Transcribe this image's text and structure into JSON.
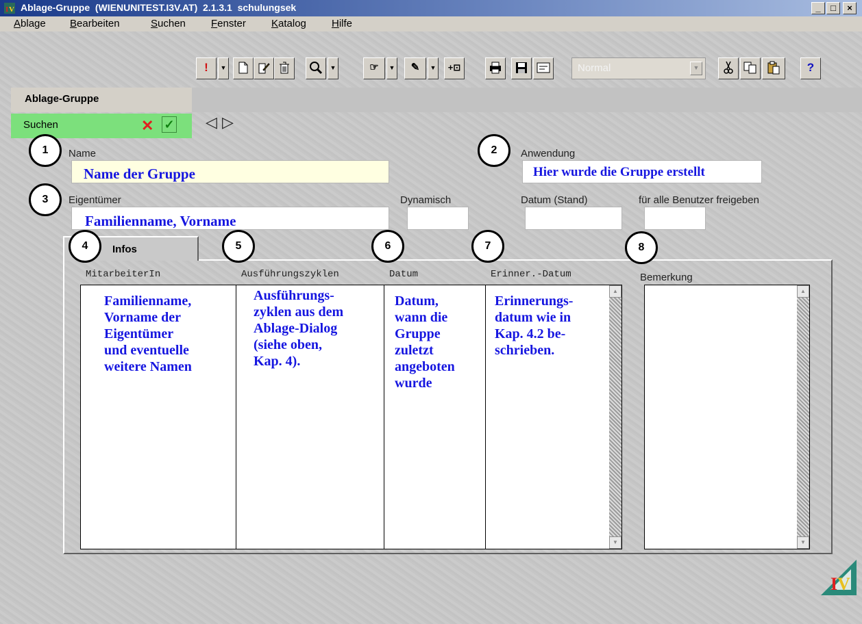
{
  "window": {
    "title": "Ablage-Gruppe  (WIENUNITEST.I3V.AT)  2.1.3.1  schulungsek",
    "minimize": "_",
    "maximize": "□",
    "close": "×"
  },
  "menu": [
    {
      "key": "A",
      "rest": "blage"
    },
    {
      "key": "B",
      "rest": "earbeiten"
    },
    {
      "key": "S",
      "rest": "uchen"
    },
    {
      "key": "F",
      "rest": "enster"
    },
    {
      "key": "K",
      "rest": "atalog"
    },
    {
      "key": "H",
      "rest": "ilfe"
    }
  ],
  "toolbar": {
    "style_select_value": "Normal",
    "help": "?"
  },
  "dialog": {
    "title": "Ablage-Gruppe",
    "mode_label": "Suchen"
  },
  "fields": {
    "name_label": "Name",
    "name_note": "Name der Gruppe",
    "anwendung_label": "Anwendung",
    "anwendung_note": "Hier wurde die Gruppe erstellt",
    "eigentuemer_label": "Eigentümer",
    "eigentuemer_note": "Familienname, Vorname",
    "dynamisch_label": "Dynamisch",
    "datum_stand_label": "Datum (Stand)",
    "freigeben_label": "für alle Benutzer freigeben"
  },
  "tab": {
    "label": "Infos"
  },
  "columns": {
    "mitarbeiter": "MitarbeiterIn",
    "zyklen": "Ausführungszyklen",
    "datum": "Datum",
    "erinner": "Erinner.-Datum",
    "bemerkung": "Bemerkung"
  },
  "notes": {
    "col1": [
      "Familienname,",
      "Vorname der",
      "Eigentümer",
      "und eventuelle",
      "weitere Namen"
    ],
    "col2": [
      "Ausführungs-",
      "zyklen aus dem",
      "Ablage-Dialog",
      "(siehe oben,",
      "Kap. 4)."
    ],
    "col3": [
      "Datum,",
      "wann die",
      "Gruppe",
      "zuletzt",
      "angeboten",
      "wurde"
    ],
    "col4": [
      "Erinnerungs-",
      "datum wie in",
      "Kap. 4.2 be-",
      "schrieben."
    ]
  },
  "markers": [
    "1",
    "2",
    "3",
    "4",
    "5",
    "6",
    "7",
    "8"
  ]
}
